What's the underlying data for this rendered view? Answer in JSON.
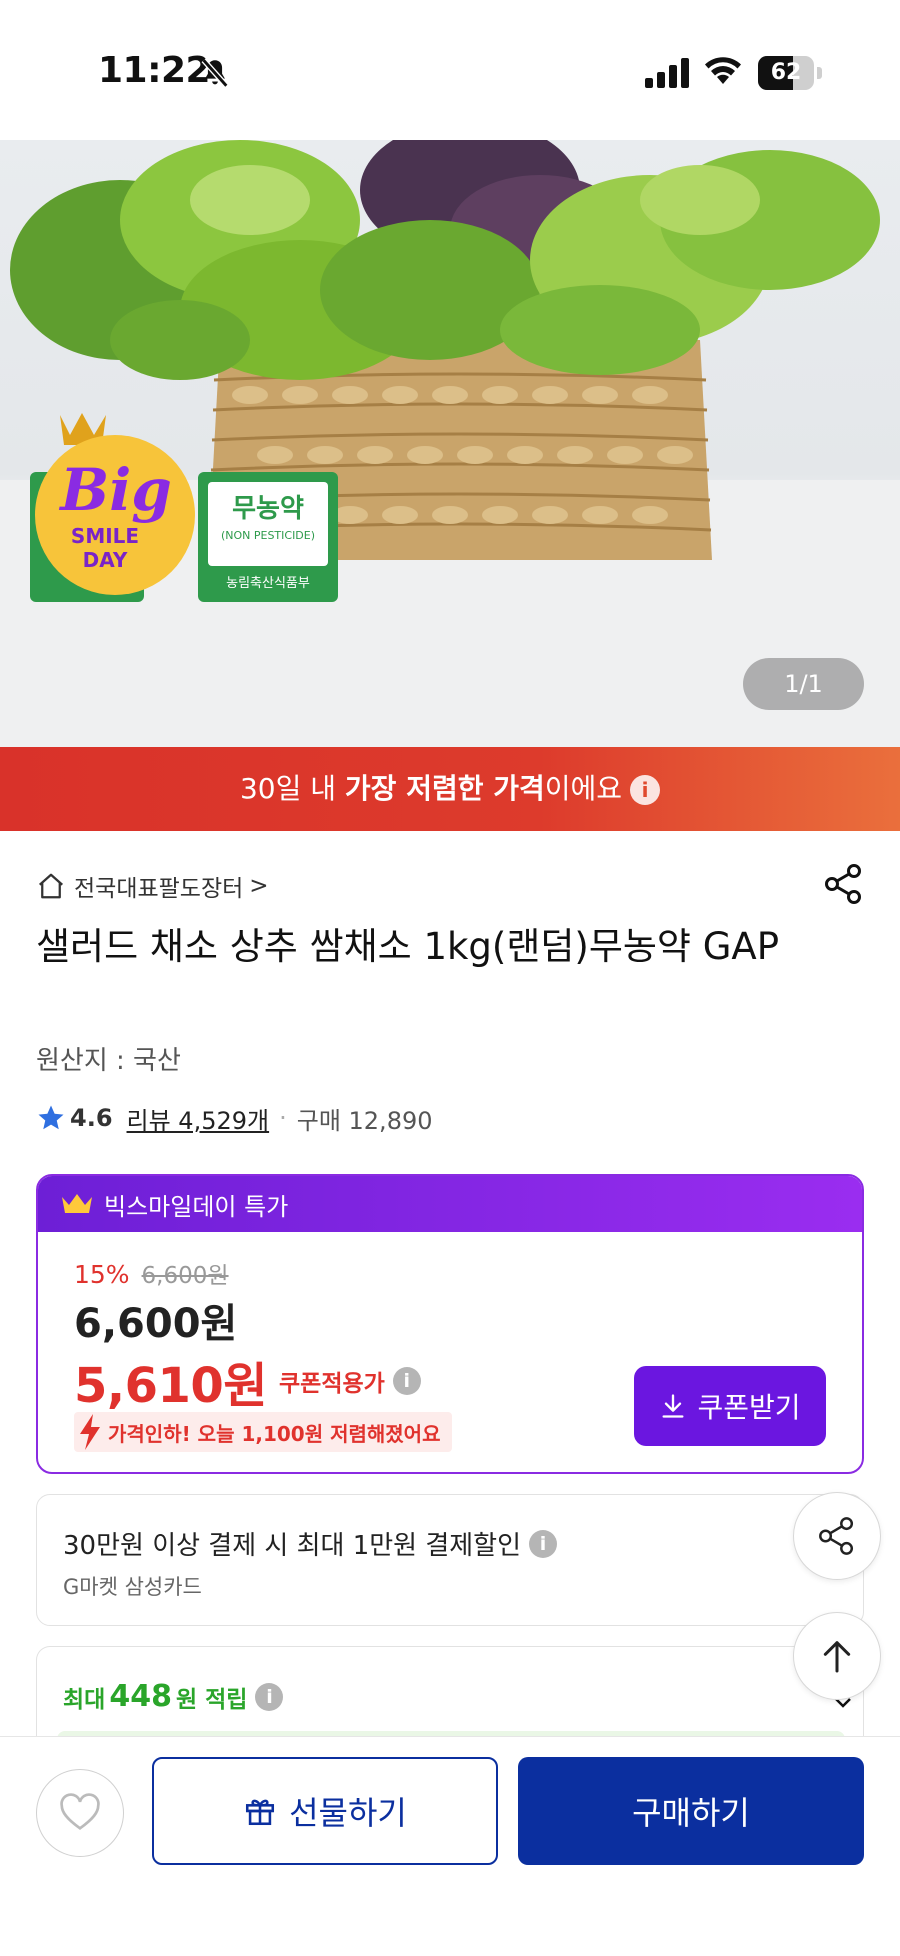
{
  "status_bar": {
    "time": "11:22",
    "battery_level": 62,
    "battery_text": "62"
  },
  "hero": {
    "page_indicator": "1/1",
    "badge_big": "Big",
    "badge_smile_day_line1": "SMILE",
    "badge_smile_day_line2": "DAY",
    "cert_title": "무농약",
    "cert_sub": "(NON PESTICIDE)",
    "cert_issuer": "농림축산식품부"
  },
  "promo_banner": {
    "prefix": "30일 내 ",
    "bold": "가장 저렴한 가격",
    "suffix": "이에요"
  },
  "seller": {
    "name": "전국대표팔도장터",
    "chevron": ">"
  },
  "product": {
    "title": "샐러드 채소 상추 쌈채소 1kg(랜덤)무농약 GAP",
    "origin": "원산지 : 국산"
  },
  "rating": {
    "score": "4.6",
    "reviews": "리뷰 4,529개",
    "separator": "·",
    "purchases": "구매 12,890"
  },
  "deal": {
    "header": "빅스마일데이 특가",
    "discount_pct": "15%",
    "original_price": "6,600원",
    "sale_price": "6,600원",
    "coupon_price": "5,610원",
    "coupon_price_label": "쿠폰적용가",
    "price_drop": "가격인하! 오늘 1,100원 저렴해졌어요",
    "coupon_button": "쿠폰받기"
  },
  "card_discount": {
    "title": "30만원 이상 결제 시 최대 1만원 결제할인",
    "card": "G마켓 삼성카드"
  },
  "points": {
    "prefix": "최대",
    "amount": "448",
    "suffix": "원 적립"
  },
  "bottom_bar": {
    "gift_label": "선물하기",
    "buy_label": "구매하기"
  },
  "colors": {
    "primary_blue": "#0b2f9f",
    "deal_purple": "#6b16e0",
    "sale_red": "#e0322d",
    "points_green": "#2aa52a",
    "banner_red": "#d9322a",
    "banner_orange": "#ea6f3c"
  }
}
